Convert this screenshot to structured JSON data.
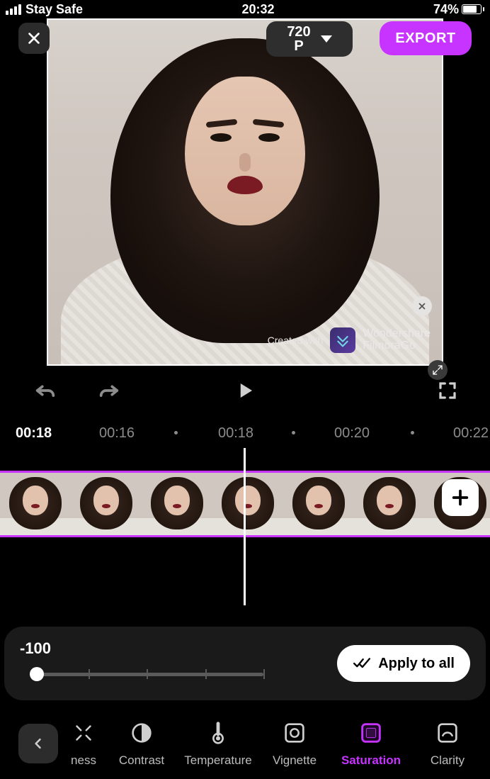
{
  "status": {
    "carrier": "Stay Safe",
    "time": "20:32",
    "battery_pct": "74%"
  },
  "topbar": {
    "resolution_line1": "720",
    "resolution_line2": "P",
    "export_label": "EXPORT"
  },
  "preview": {
    "watermark_prefix": "Created with",
    "watermark_brand_line1": "Wondershare",
    "watermark_brand_line2": "FilmoraGo"
  },
  "ruler": {
    "current": "00:18",
    "ticks": [
      "00:16",
      "00:18",
      "00:20",
      "00:22"
    ]
  },
  "adjust": {
    "value_label": "-100",
    "apply_all_label": "Apply to all"
  },
  "tools": {
    "items": [
      {
        "id": "brightness",
        "label": "ness"
      },
      {
        "id": "contrast",
        "label": "Contrast"
      },
      {
        "id": "temperature",
        "label": "Temperature"
      },
      {
        "id": "vignette",
        "label": "Vignette"
      },
      {
        "id": "saturation",
        "label": "Saturation"
      },
      {
        "id": "clarity",
        "label": "Clarity"
      }
    ],
    "active": "saturation"
  },
  "colors": {
    "accent": "#c733ff"
  }
}
